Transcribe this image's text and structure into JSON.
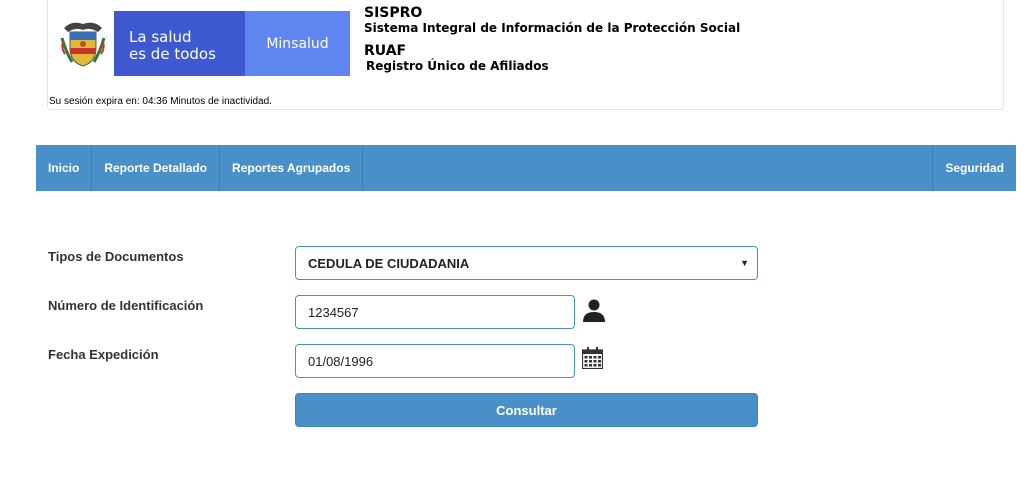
{
  "header": {
    "brand_line1": "La salud",
    "brand_line2": "es de todos",
    "brand_ministry": "Minsalud",
    "sispro_title": "SISPRO",
    "sispro_subtitle": "Sistema Integral de Información de la Protección Social",
    "ruaf_title": "RUAF",
    "ruaf_subtitle": "Registro Único de Afiliados",
    "session_text": "Su sesión expira en: 04:36 Minutos de inactividad."
  },
  "nav": {
    "items": [
      "Inicio",
      "Reporte Detallado",
      "Reportes Agrupados"
    ],
    "right_item": "Seguridad"
  },
  "form": {
    "doc_type_label": "Tipos de Documentos",
    "doc_type_value": "CEDULA DE CIUDADANIA",
    "id_label": "Número de Identificación",
    "id_value": "1234567",
    "date_label": "Fecha Expedición",
    "date_value": "01/08/1996",
    "submit_label": "Consultar"
  },
  "icons": {
    "coat_of_arms": "colombia-coat-of-arms-icon",
    "user": "user-icon",
    "calendar": "calendar-icon",
    "dropdown": "chevron-down-icon"
  },
  "colors": {
    "nav_bg": "#4a90c8",
    "brand_dark": "#3e59cf",
    "brand_light": "#5e86ee",
    "button_bg": "#4a90c8"
  }
}
